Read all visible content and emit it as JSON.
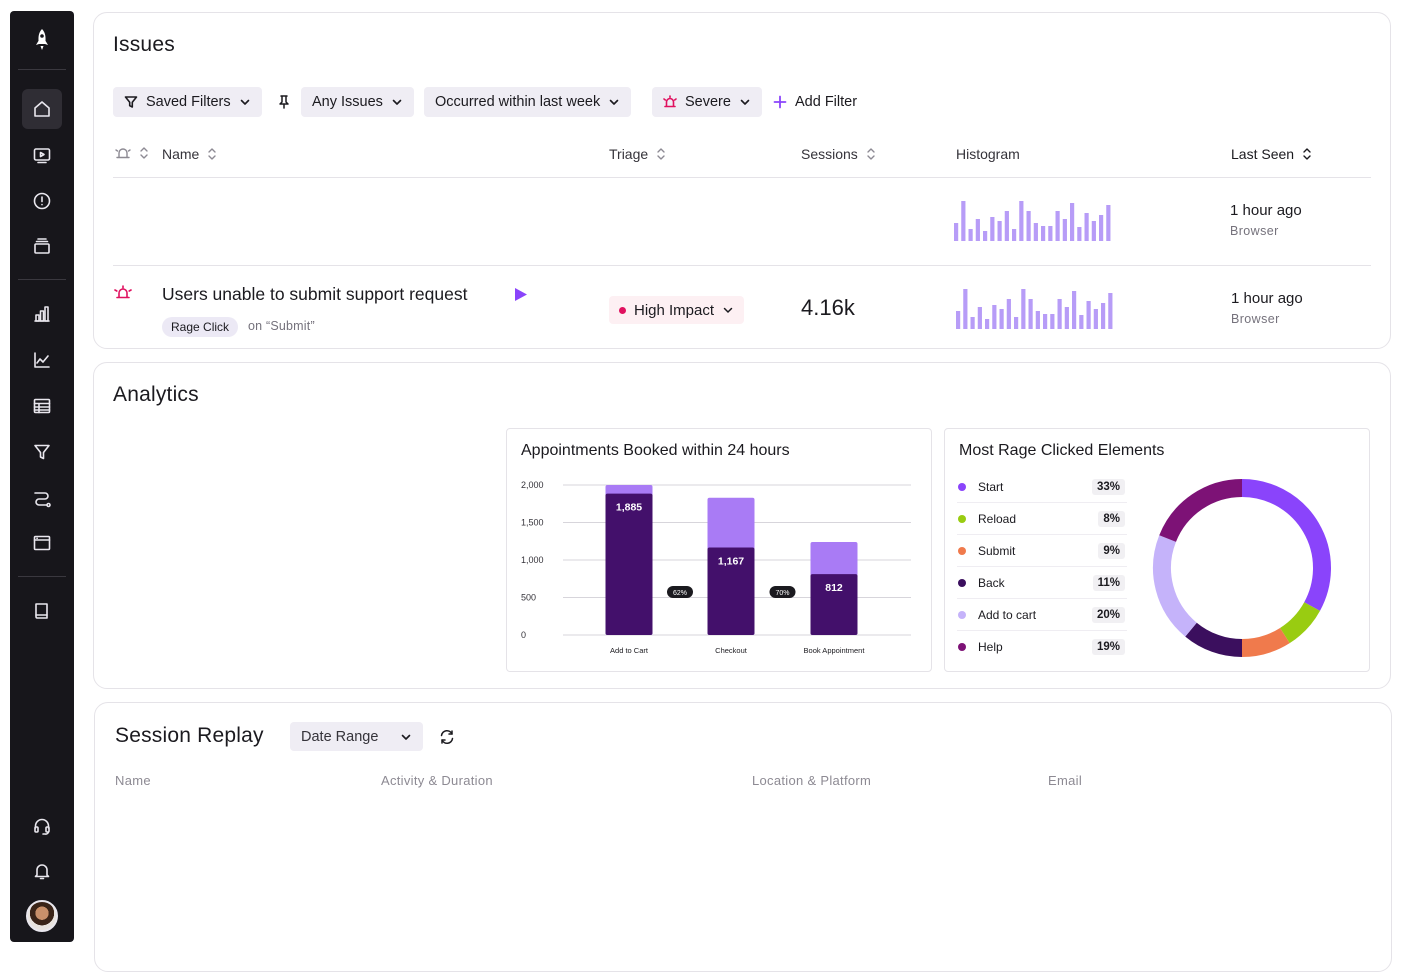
{
  "sidebar": {
    "icons": [
      "rocket-icon",
      "home-icon",
      "video-icon",
      "alert-icon",
      "stack-icon",
      "bar-chart-icon",
      "line-chart-icon",
      "table-icon",
      "funnel-icon",
      "path-icon",
      "window-icon",
      "book-icon",
      "headset-icon",
      "bell-icon"
    ]
  },
  "issues": {
    "title": "Issues",
    "filters": {
      "saved": "Saved Filters",
      "any_issues": "Any Issues",
      "occurred": "Occurred within last week",
      "severity": "Severe",
      "add": "Add Filter"
    },
    "columns": {
      "name": "Name",
      "triage": "Triage",
      "sessions": "Sessions",
      "histogram": "Histogram",
      "last_seen": "Last Seen"
    },
    "rows": [
      {
        "title": "",
        "last_seen": "1 hour ago",
        "platform": "Browser",
        "histogram": [
          18,
          40,
          12,
          22,
          10,
          24,
          20,
          30,
          12,
          40,
          30,
          18,
          15,
          15,
          30,
          22,
          38,
          14,
          28,
          20,
          26,
          36
        ]
      },
      {
        "title": "Users unable to submit support request",
        "tag": "Rage Click",
        "tag_context": "on “Submit”",
        "triage": "High Impact",
        "sessions": "4.16k",
        "last_seen": "1 hour ago",
        "platform": "Browser",
        "histogram": [
          18,
          40,
          12,
          22,
          10,
          24,
          20,
          30,
          12,
          40,
          30,
          18,
          15,
          15,
          30,
          22,
          38,
          14,
          28,
          20,
          26,
          36
        ]
      }
    ]
  },
  "analytics": {
    "title": "Analytics"
  },
  "chart_data": [
    {
      "type": "bar",
      "title": "Appointments Booked within 24 hours",
      "categories": [
        "Add to Cart",
        "Checkout",
        "Book Appointment"
      ],
      "series": [
        {
          "values": [
            1885,
            1167,
            812
          ]
        },
        {
          "values": [
            2000,
            1830,
            1240
          ]
        }
      ],
      "data_labels": [
        "1,885",
        "1,167",
        "812"
      ],
      "conversion_labels": [
        "62%",
        "70%"
      ],
      "yticks": [
        "2,000",
        "1,500",
        "1,000",
        "500",
        "0"
      ],
      "ylim": [
        0,
        2000
      ],
      "grid": true,
      "colors": {
        "primary": "#43106b",
        "secondary": "#a97bf5"
      }
    },
    {
      "type": "pie",
      "title": "Most Rage Clicked Elements",
      "labels": [
        "Start",
        "Reload",
        "Submit",
        "Back",
        "Add to cart",
        "Help"
      ],
      "values": [
        33,
        8,
        9,
        11,
        20,
        19
      ],
      "value_labels": [
        "33%",
        "8%",
        "9%",
        "11%",
        "20%",
        "19%"
      ],
      "colors": [
        "#8a44fb",
        "#99cc11",
        "#f07a4c",
        "#3b0f5e",
        "#c5b3fa",
        "#7d1276"
      ]
    }
  ],
  "session_replay": {
    "title": "Session Replay",
    "date_range": "Date Range",
    "columns": [
      "Name",
      "Activity & Duration",
      "Location & Platform",
      "Email"
    ]
  }
}
